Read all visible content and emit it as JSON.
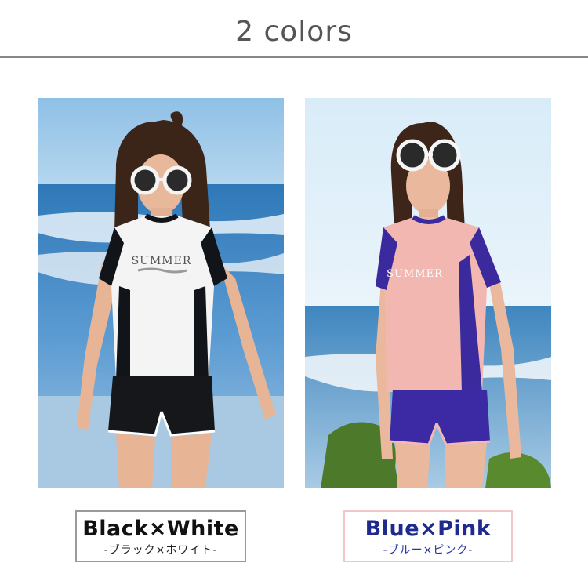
{
  "header": {
    "title": "2 colors"
  },
  "variants": [
    {
      "name": "Black×White",
      "subtitle": "-ブラック×ホワイト-",
      "shirt_print": "SUMMER",
      "colors": {
        "sleeve": "#111418",
        "body": "#f4f4f4",
        "shorts": "#15171b",
        "trim": "#ffffff"
      }
    },
    {
      "name": "Blue×Pink",
      "subtitle": "-ブルー×ピンク-",
      "shirt_print": "SUMMER",
      "colors": {
        "sleeve": "#3a2a9e",
        "body": "#f2b7b0",
        "shorts": "#3b2aa4",
        "trim": "#f5b9b1"
      }
    }
  ]
}
